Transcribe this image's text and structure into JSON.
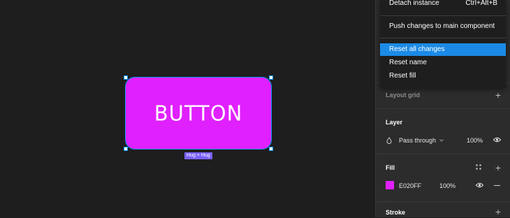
{
  "canvas": {
    "button_text": "BUTTON",
    "sizing_badge": "Hug × Hug",
    "fill_color": "#e020ff"
  },
  "menu": {
    "items": [
      {
        "label": "Detach instance",
        "shortcut": "Ctrl+Alt+B"
      },
      {
        "label": "Push changes to main component"
      },
      {
        "label": "Reset all changes",
        "highlighted": true
      },
      {
        "label": "Reset name"
      },
      {
        "label": "Reset fill"
      }
    ]
  },
  "panel": {
    "layout_grid": {
      "title": "Layout grid"
    },
    "layer": {
      "title": "Layer",
      "blend_mode": "Pass through",
      "opacity": "100%"
    },
    "fill": {
      "title": "Fill",
      "hex": "E020FF",
      "opacity": "100%",
      "swatch": "#e020ff"
    },
    "stroke": {
      "title": "Stroke"
    }
  },
  "colors": {
    "accent": "#1b8ae6",
    "selection": "#0d99ff",
    "badge": "#7b61ff"
  }
}
